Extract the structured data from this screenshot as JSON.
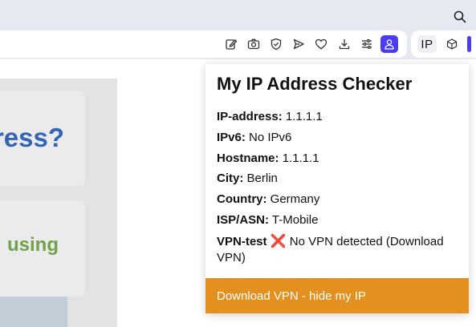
{
  "toolbar": {
    "icons": [
      "edit-icon",
      "camera-icon",
      "shield-icon",
      "send-icon",
      "heart-icon",
      "download-icon",
      "sliders-icon",
      "profile-icon"
    ],
    "extension_ip_label": "IP",
    "accent_color": "#4a3cf0"
  },
  "page": {
    "card1_text": "ress?",
    "card2_text": "using",
    "card1_color": "#3465b5",
    "card2_color": "#6fa24a"
  },
  "popup": {
    "title": "My IP Address Checker",
    "rows": [
      {
        "label": "IP-address:",
        "value": "1.1.1.1"
      },
      {
        "label": "IPv6:",
        "value": "No IPv6"
      },
      {
        "label": "Hostname:",
        "value": "1.1.1.1"
      },
      {
        "label": "City:",
        "value": "Berlin"
      },
      {
        "label": "Country:",
        "value": "Germany"
      },
      {
        "label": "ISP/ASN:",
        "value": "T-Mobile"
      }
    ],
    "vpn_label": "VPN-test",
    "vpn_mark": "❌",
    "vpn_value": "No VPN detected (Download VPN)",
    "download_button": "Download VPN - hide my IP",
    "button_color": "#e3901f"
  }
}
